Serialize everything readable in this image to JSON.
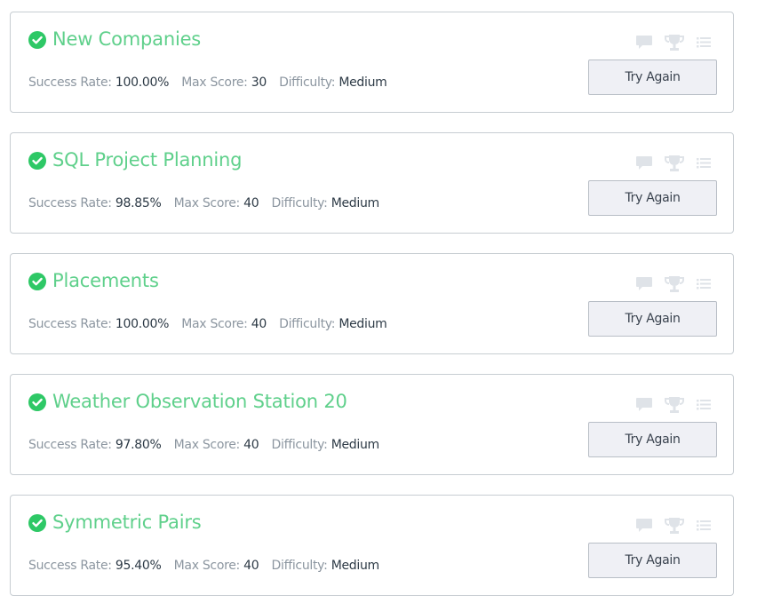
{
  "labels": {
    "success_rate": "Success Rate:",
    "max_score": "Max Score:",
    "difficulty": "Difficulty:"
  },
  "colors": {
    "solved_check": "#2ec866",
    "title": "#5fd08b",
    "icon_gray": "#dfe3e8"
  },
  "challenges": [
    {
      "title": "New Companies",
      "success_rate": "100.00%",
      "max_score": "30",
      "difficulty": "Medium",
      "button": "Try Again",
      "status": "solved"
    },
    {
      "title": "SQL Project Planning",
      "success_rate": "98.85%",
      "max_score": "40",
      "difficulty": "Medium",
      "button": "Try Again",
      "status": "solved"
    },
    {
      "title": "Placements",
      "success_rate": "100.00%",
      "max_score": "40",
      "difficulty": "Medium",
      "button": "Try Again",
      "status": "solved"
    },
    {
      "title": "Weather Observation Station 20",
      "success_rate": "97.80%",
      "max_score": "40",
      "difficulty": "Medium",
      "button": "Try Again",
      "status": "solved"
    },
    {
      "title": "Symmetric Pairs",
      "success_rate": "95.40%",
      "max_score": "40",
      "difficulty": "Medium",
      "button": "Try Again",
      "status": "solved"
    }
  ],
  "card_icons": [
    "discussion-icon",
    "leaderboard-trophy-icon",
    "editorial-list-icon"
  ]
}
